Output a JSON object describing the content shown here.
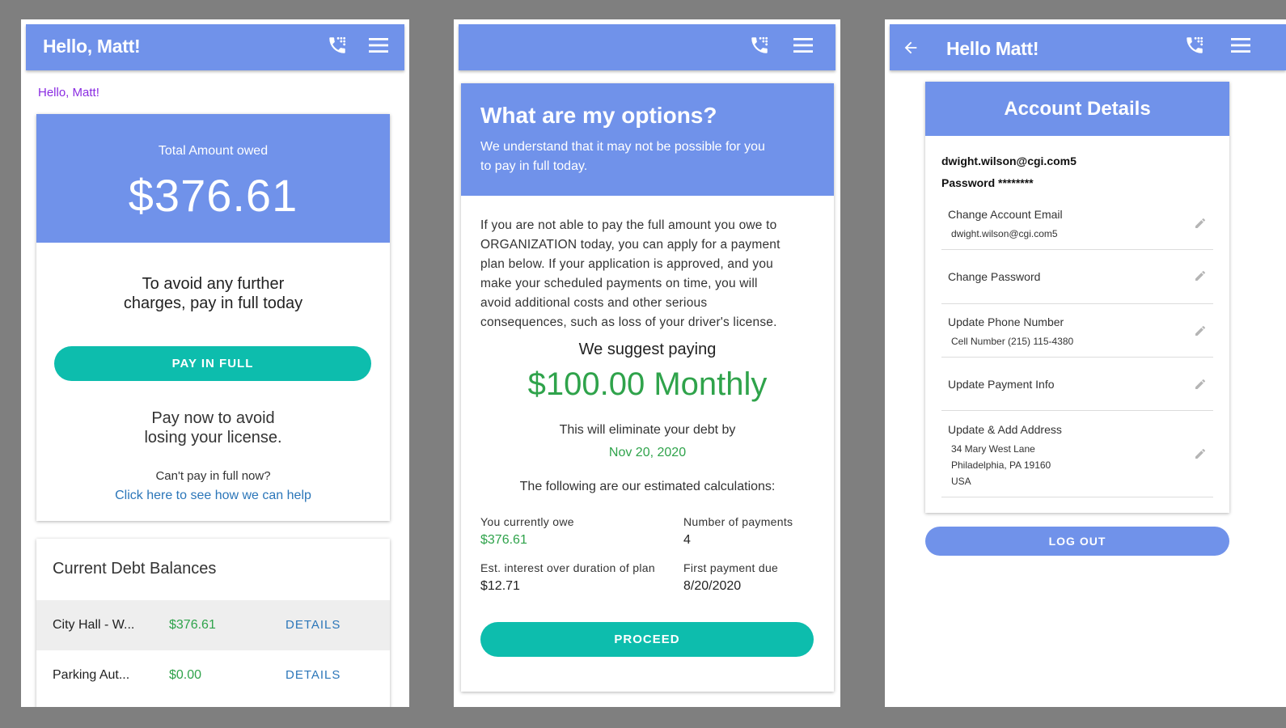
{
  "colors": {
    "app_bar": "#7092ea",
    "accent_teal": "#0dbdad",
    "money_green": "#2fa34b",
    "link_blue": "#2b76b9",
    "greeting_purple": "#8a2be2",
    "backdrop": "#7f7f7f"
  },
  "icons": {
    "phone": "phone-dial-icon",
    "menu": "hamburger-menu-icon",
    "back": "back-arrow-icon",
    "edit": "pencil-icon"
  },
  "screen1": {
    "appbar_title": "Hello, Matt!",
    "greeting": "Hello, Matt!",
    "total_label": "Total Amount owed",
    "total_amount": "$376.61",
    "avoid_line1": "To avoid any further",
    "avoid_line2": "charges, pay in full today",
    "pay_button": "PAY IN FULL",
    "license_line1": "Pay now to avoid",
    "license_line2": "losing your license.",
    "cant_pay": "Can't pay in full now?",
    "help_link": "Click here to see how we can help",
    "debts_title": "Current Debt Balances",
    "debts": [
      {
        "name": "City Hall - W...",
        "amount": "$376.61",
        "action": "DETAILS"
      },
      {
        "name": "Parking Aut...",
        "amount": "$0.00",
        "action": "DETAILS"
      }
    ]
  },
  "screen2": {
    "heading": "What are my options?",
    "subheading_line1": "We understand that it may not be possible for you",
    "subheading_line2": "to pay in full today.",
    "body_lines": [
      "If you are not able to pay the full amount you owe to",
      "ORGANIZATION today, you can apply for a payment",
      "plan below. If your application is approved, and you",
      "make your scheduled payments on time, you will",
      "avoid additional costs and other serious",
      "consequences, such as loss of your driver's license."
    ],
    "suggest_label": "We suggest paying",
    "suggest_amount": "$100.00 Monthly",
    "eliminate_label": "This will eliminate your debt by",
    "eliminate_date": "Nov 20, 2020",
    "calc_label": "The following are our estimated calculations:",
    "owe_label": "You currently owe",
    "owe_value": "$376.61",
    "payments_label": "Number of payments",
    "payments_value": "4",
    "interest_label": "Est. interest over duration of plan",
    "interest_value": "$12.71",
    "first_due_label": "First payment due",
    "first_due_value": "8/20/2020",
    "proceed_button": "PROCEED"
  },
  "screen3": {
    "appbar_title": "Hello Matt!",
    "card_title": "Account Details",
    "email": "dwight.wilson@cgi.com5",
    "password_label": "Password",
    "password_mask": "********",
    "rows": [
      {
        "title": "Change Account Email",
        "details": [
          "dwight.wilson@cgi.com5"
        ]
      },
      {
        "title": "Change Password",
        "details": []
      },
      {
        "title": "Update Phone Number",
        "details": [
          "Cell Number (215) 115-4380"
        ]
      },
      {
        "title": "Update Payment Info",
        "details": []
      },
      {
        "title": "Update & Add Address",
        "details": [
          "34 Mary West Lane",
          "Philadelphia, PA 19160",
          "USA"
        ]
      }
    ],
    "logout_button": "LOG OUT"
  }
}
